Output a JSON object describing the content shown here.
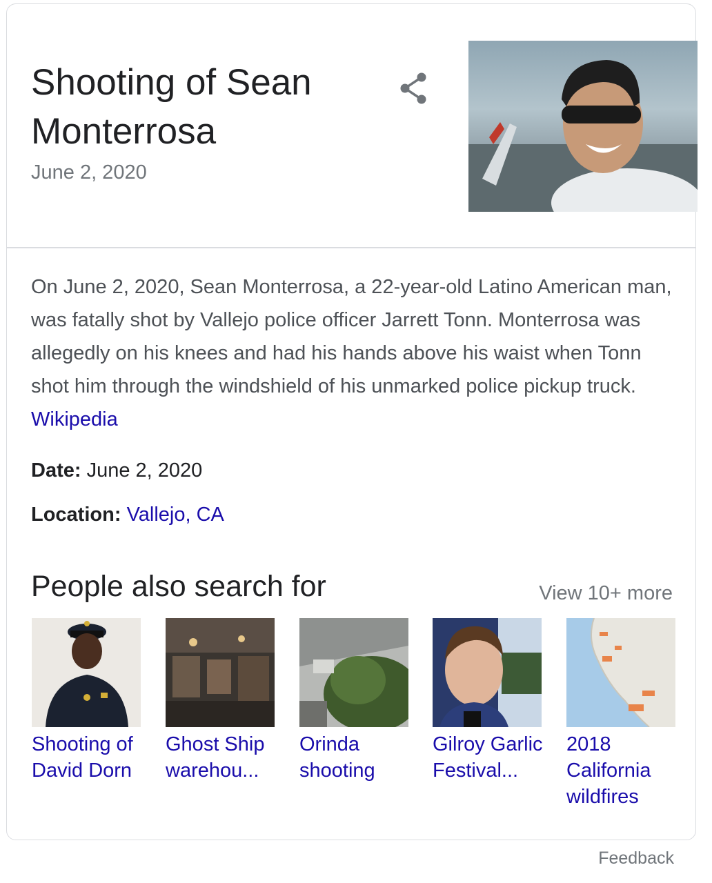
{
  "panel": {
    "title": "Shooting of Sean Monterrosa",
    "subtitle": "June 2, 2020",
    "share_icon": "share-icon",
    "hero_image": "photo-sean-monterrosa"
  },
  "description": {
    "text": "On June 2, 2020, Sean Monterrosa, a 22-year-old Latino American man, was fatally shot by Vallejo police officer Jarrett Tonn. Monterrosa was allegedly on his knees and had his hands above his waist when Tonn shot him through the windshield of his unmarked police pickup truck. ",
    "source_link": "Wikipedia"
  },
  "facts": {
    "date_label": "Date:",
    "date_value": "June 2, 2020",
    "location_label": "Location:",
    "location_value": "Vallejo, CA"
  },
  "people_also_search": {
    "title": "People also search for",
    "view_more": "View 10+ more",
    "items": [
      {
        "label": "Shooting of David Dorn"
      },
      {
        "label": "Ghost Ship warehou..."
      },
      {
        "label": "Orinda shooting"
      },
      {
        "label": "Gilroy Garlic Festival..."
      },
      {
        "label": "2018 California wildfires"
      }
    ]
  },
  "footer": {
    "feedback": "Feedback"
  },
  "colors": {
    "link": "#1a0dab",
    "text_primary": "#202124",
    "text_secondary": "#70757a",
    "body_text": "#4d5156",
    "border": "#dadce0"
  }
}
